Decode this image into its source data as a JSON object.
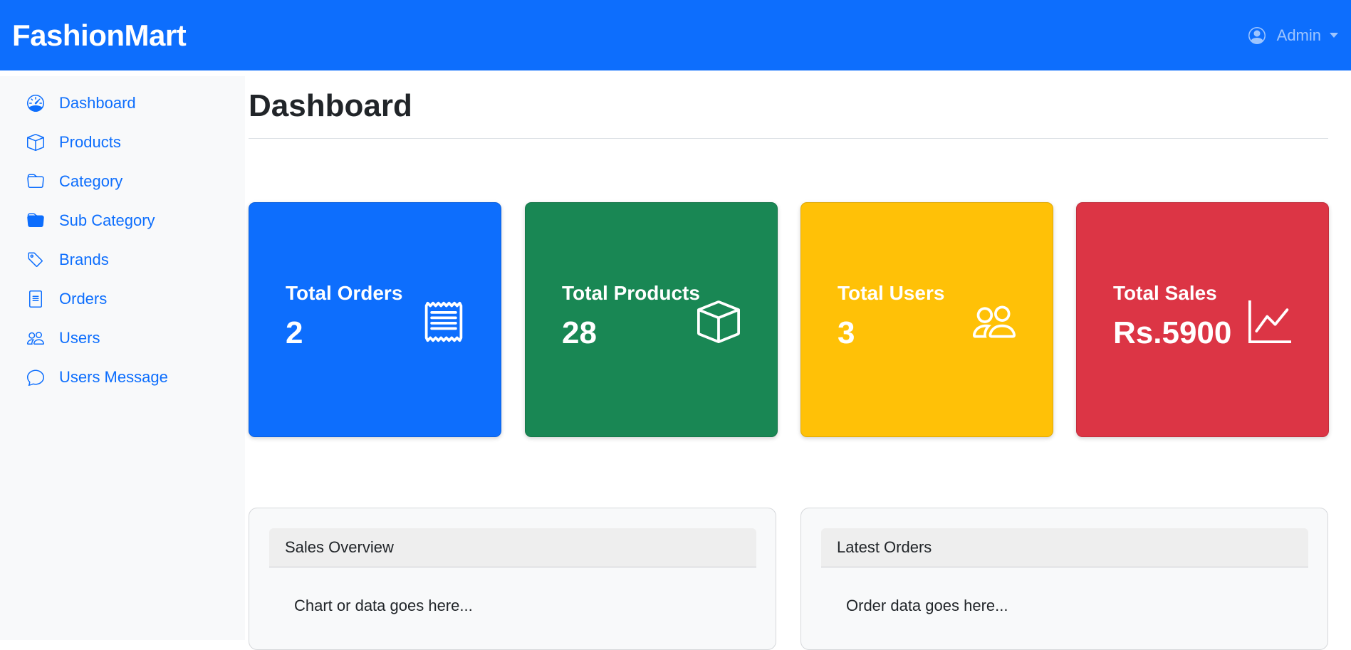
{
  "navbar": {
    "brand": "FashionMart",
    "user_label": "Admin"
  },
  "sidebar": {
    "items": [
      {
        "label": "Dashboard",
        "icon": "speedometer-icon"
      },
      {
        "label": "Products",
        "icon": "box-icon"
      },
      {
        "label": "Category",
        "icon": "folder-icon"
      },
      {
        "label": "Sub Category",
        "icon": "folder-filled-icon"
      },
      {
        "label": "Brands",
        "icon": "tag-icon"
      },
      {
        "label": "Orders",
        "icon": "receipt-icon"
      },
      {
        "label": "Users",
        "icon": "people-icon"
      },
      {
        "label": "Users Message",
        "icon": "chat-icon"
      }
    ]
  },
  "main": {
    "title": "Dashboard",
    "stats": [
      {
        "label": "Total Orders",
        "value": "2",
        "icon": "receipt-icon",
        "color": "#0d6efd"
      },
      {
        "label": "Total Products",
        "value": "28",
        "icon": "box-icon",
        "color": "#198754"
      },
      {
        "label": "Total Users",
        "value": "3",
        "icon": "people-icon",
        "color": "#ffc107"
      },
      {
        "label": "Total Sales",
        "value": "Rs.5900",
        "icon": "graph-up-icon",
        "color": "#dc3545"
      }
    ],
    "panels": [
      {
        "title": "Sales Overview",
        "body": "Chart or data goes here..."
      },
      {
        "title": "Latest Orders",
        "body": "Order data goes here..."
      }
    ]
  },
  "colors": {
    "primary": "#0d6efd",
    "success": "#198754",
    "warning": "#ffc107",
    "danger": "#dc3545",
    "sidebar_bg": "#f8f9fa"
  }
}
